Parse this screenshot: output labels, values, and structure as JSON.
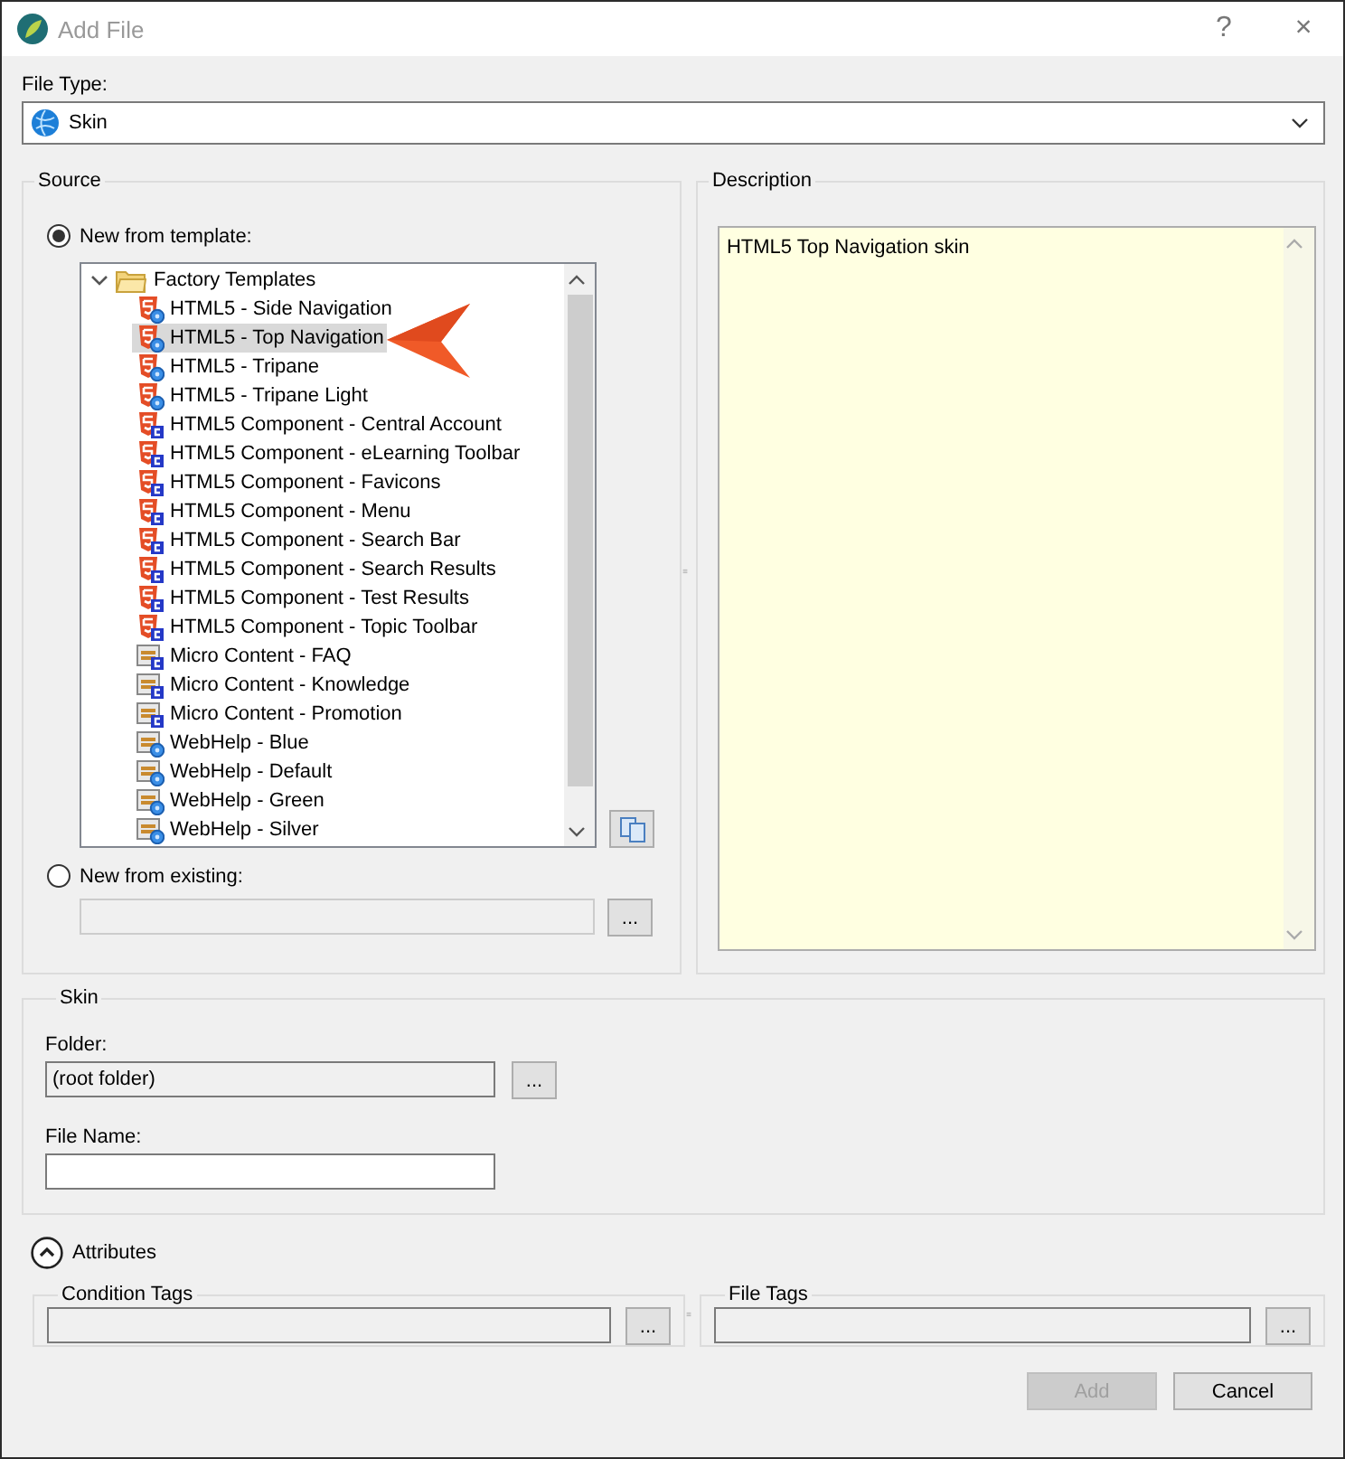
{
  "window": {
    "title": "Add File",
    "help": "?",
    "close": "×"
  },
  "file_type": {
    "label": "File Type:",
    "value": "Skin"
  },
  "source": {
    "title": "Source",
    "options": [
      {
        "label": "New from template:",
        "selected": true
      },
      {
        "label": "New from existing:",
        "selected": false
      }
    ],
    "tree": [
      {
        "label": "Factory Templates",
        "expanded": true,
        "selected": false,
        "children": [
          {
            "label": "HTML5 - Side Navigation",
            "kind": "html5",
            "selected": false
          },
          {
            "label": "HTML5 - Top Navigation",
            "kind": "html5",
            "selected": true
          },
          {
            "label": "HTML5 - Tripane",
            "kind": "html5",
            "selected": false
          },
          {
            "label": "HTML5 - Tripane Light",
            "kind": "html5",
            "selected": false
          },
          {
            "label": "HTML5 Component - Central Account",
            "kind": "component",
            "selected": false
          },
          {
            "label": "HTML5 Component - eLearning Toolbar",
            "kind": "component",
            "selected": false
          },
          {
            "label": "HTML5 Component - Favicons",
            "kind": "component",
            "selected": false
          },
          {
            "label": "HTML5 Component - Menu",
            "kind": "component",
            "selected": false
          },
          {
            "label": "HTML5 Component - Search Bar",
            "kind": "component",
            "selected": false
          },
          {
            "label": "HTML5 Component - Search Results",
            "kind": "component",
            "selected": false
          },
          {
            "label": "HTML5 Component - Test Results",
            "kind": "component",
            "selected": false
          },
          {
            "label": "HTML5 Component - Topic Toolbar",
            "kind": "component",
            "selected": false
          },
          {
            "label": "Micro Content - FAQ",
            "kind": "micro",
            "selected": false
          },
          {
            "label": "Micro Content - Knowledge",
            "kind": "micro",
            "selected": false
          },
          {
            "label": "Micro Content - Promotion",
            "kind": "micro",
            "selected": false
          },
          {
            "label": "WebHelp - Blue",
            "kind": "webhelp",
            "selected": false
          },
          {
            "label": "WebHelp - Default",
            "kind": "webhelp",
            "selected": false
          },
          {
            "label": "WebHelp - Green",
            "kind": "webhelp",
            "selected": false
          },
          {
            "label": "WebHelp - Silver",
            "kind": "webhelp",
            "selected": false
          }
        ]
      }
    ],
    "browse_button": "..."
  },
  "description": {
    "title": "Description",
    "text": "HTML5 Top Navigation skin"
  },
  "skin": {
    "title": "Skin",
    "folder": {
      "label": "Folder:",
      "value": "(root folder)",
      "button": "..."
    },
    "file_name": {
      "label": "File Name:"
    }
  },
  "attributes": {
    "label": "Attributes",
    "expanded": true,
    "groups": [
      {
        "title": "Condition Tags",
        "button": "..."
      },
      {
        "title": "File Tags",
        "button": "..."
      }
    ]
  },
  "buttons": [
    {
      "label": "Add",
      "disabled": true
    },
    {
      "label": "Cancel",
      "disabled": false
    }
  ]
}
